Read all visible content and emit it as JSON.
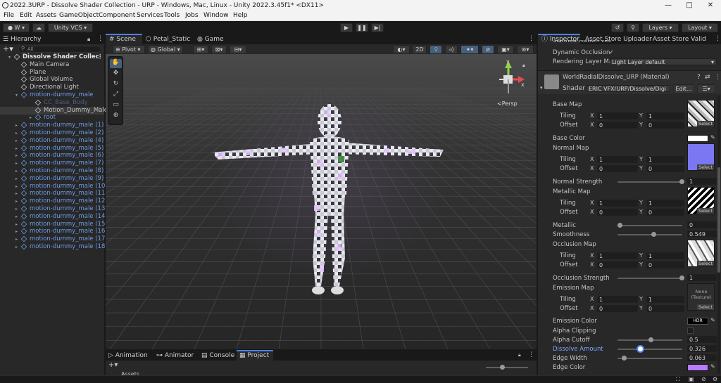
{
  "window": {
    "title": "2022.3URP - Dissolve Shader Collection - URP - Windows, Mac, Linux - Unity 2022.3.45f1* <DX11>",
    "controls": [
      "—",
      "□",
      "✕"
    ]
  },
  "menu": [
    "File",
    "Edit",
    "Assets",
    "GameObject",
    "Component",
    "Services",
    "Tools",
    "Jobs",
    "Window",
    "Help"
  ],
  "toolbar": {
    "account_label": "W",
    "vcs_label": "Unity VCS",
    "layers_label": "Layers",
    "layout_label": "Layout"
  },
  "hierarchy": {
    "tab": "Hierarchy",
    "search_placeholder": "All",
    "items": [
      {
        "label": "Dissolve Shader Collec",
        "kind": "scene"
      },
      {
        "label": "Main Camera",
        "kind": "object"
      },
      {
        "label": "Plane",
        "kind": "object"
      },
      {
        "label": "Global Volume",
        "kind": "object"
      },
      {
        "label": "Directional Light",
        "kind": "object"
      },
      {
        "label": "motion-dummy_male",
        "kind": "prefab"
      },
      {
        "label": "CC_Base_Body",
        "kind": "disabled"
      },
      {
        "label": "Motion_Dummy_Male",
        "kind": "selected"
      },
      {
        "label": "root",
        "kind": "prefab"
      },
      {
        "label": "motion-dummy_male (1)",
        "kind": "prefab"
      },
      {
        "label": "motion-dummy_male (2)",
        "kind": "prefab"
      },
      {
        "label": "motion-dummy_male (4)",
        "kind": "prefab"
      },
      {
        "label": "motion-dummy_male (5)",
        "kind": "prefab"
      },
      {
        "label": "motion-dummy_male (6)",
        "kind": "prefab"
      },
      {
        "label": "motion-dummy_male (7)",
        "kind": "prefab"
      },
      {
        "label": "motion-dummy_male (8)",
        "kind": "prefab"
      },
      {
        "label": "motion-dummy_male (9)",
        "kind": "prefab"
      },
      {
        "label": "motion-dummy_male (10)",
        "kind": "prefab"
      },
      {
        "label": "motion-dummy_male (11)",
        "kind": "prefab"
      },
      {
        "label": "motion-dummy_male (12)",
        "kind": "prefab"
      },
      {
        "label": "motion-dummy_male (13)",
        "kind": "prefab"
      },
      {
        "label": "motion-dummy_male (14)",
        "kind": "prefab"
      },
      {
        "label": "motion-dummy_male (15)",
        "kind": "prefab"
      },
      {
        "label": "motion-dummy_male (16)",
        "kind": "prefab"
      },
      {
        "label": "motion-dummy_male (17)",
        "kind": "prefab"
      },
      {
        "label": "motion-dummy_male (18)",
        "kind": "prefab"
      }
    ]
  },
  "scene_tabs": [
    "Scene",
    "Petal_Static",
    "Game"
  ],
  "scene_toolbar": {
    "pivot": "Pivot",
    "global": "Global",
    "mode_2d": "2D",
    "persp": "<Persp"
  },
  "bottom_tabs": [
    "Animation",
    "Animator",
    "Console",
    "Project"
  ],
  "bottom_assets": "Assets",
  "inspector": {
    "tabs": [
      "Inspector",
      "Asset Store Uploader",
      "Asset Store Valid"
    ],
    "top_rows": {
      "skinned": "Skinned Motion Vec",
      "dynamic": "Dynamic Occlusion",
      "rendering_label": "Rendering Layer Ma",
      "rendering_value": "Light Layer default"
    },
    "material": {
      "name": "WorldRadialDissolve_URP (Material)",
      "shader_label": "Shader",
      "shader_value": "ERIC VFX/URP/Dissolve/Digi",
      "edit_label": "Edit..."
    },
    "tiling_label": "Tiling",
    "offset_label": "Offset",
    "x_label": "X",
    "y_label": "Y",
    "select_label": "Select",
    "none_texture": "None (Texture)",
    "maps": [
      {
        "name": "Base Map",
        "tx": "1",
        "ty": "1",
        "ox": "0",
        "oy": "0"
      },
      {
        "name": "Normal Map",
        "tx": "1",
        "ty": "1",
        "ox": "0",
        "oy": "0"
      },
      {
        "name": "Metallic Map",
        "tx": "1",
        "ty": "1",
        "ox": "0",
        "oy": "0"
      },
      {
        "name": "Occlusion Map",
        "tx": "1",
        "ty": "1",
        "ox": "0",
        "oy": "0"
      },
      {
        "name": "Emission Map",
        "tx": "1",
        "ty": "1",
        "ox": "0",
        "oy": "0"
      }
    ],
    "props": {
      "base_color": "Base Color",
      "normal_strength": "Normal Strength",
      "normal_strength_val": "1",
      "metallic": "Metallic",
      "metallic_val": "0",
      "smoothness": "Smoothness",
      "smoothness_val": "0.549",
      "occlusion_strength": "Occlusion Strength",
      "occlusion_strength_val": "1",
      "emission_color": "Emission Color",
      "hdr": "HDR",
      "alpha_clipping": "Alpha Clipping",
      "alpha_cutoff": "Alpha Cutoff",
      "alpha_cutoff_val": "0.5",
      "dissolve_amount": "Dissolve Amount",
      "dissolve_amount_val": "0.326",
      "edge_width": "Edge Width",
      "edge_width_val": "0.063",
      "edge_color": "Edge Color"
    },
    "slider_levels": {
      "normal_strength": 1,
      "metallic": 0,
      "smoothness": 0.549,
      "occlusion_strength": 1,
      "alpha_cutoff": 0.5,
      "dissolve_amount": 0.326,
      "edge_width": 0.063
    }
  },
  "colors": {
    "accent": "#4c7fff",
    "edge_color": "#b57cff",
    "normal_map": "#7b77f2",
    "emission_glow": "#d8a8ff"
  }
}
